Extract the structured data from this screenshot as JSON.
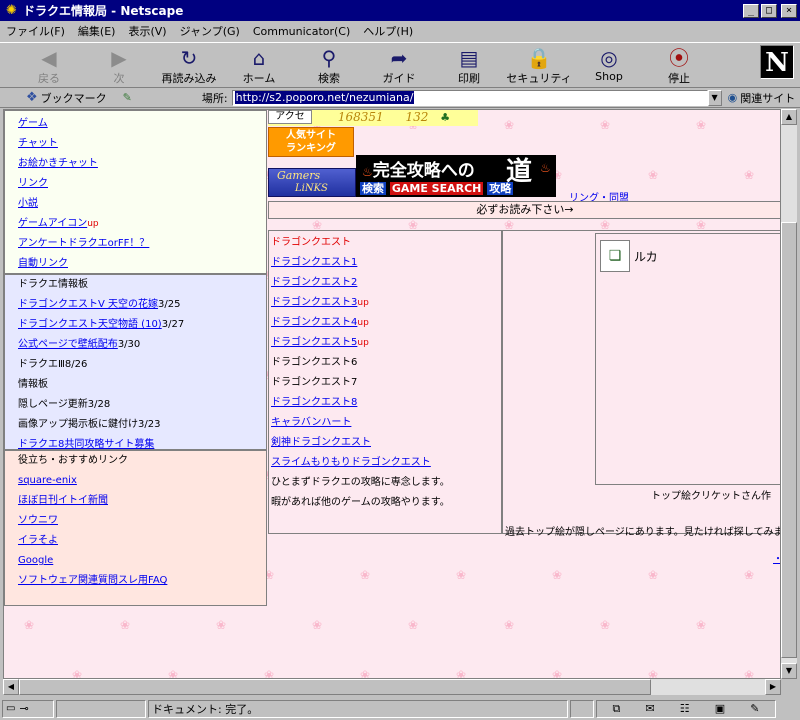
{
  "window": {
    "title": "ドラクエ情報局 - Netscape",
    "minimize": "_",
    "maximize": "□",
    "close": "×"
  },
  "menubar": [
    "ファイル(F)",
    "編集(E)",
    "表示(V)",
    "ジャンプ(G)",
    "Communicator(C)",
    "ヘルプ(H)"
  ],
  "toolbar": [
    {
      "label": "戻る",
      "icon": "back-icon",
      "glyph": "◀",
      "color": "#3a9a3a",
      "disabled": true
    },
    {
      "label": "次",
      "icon": "forward-icon",
      "glyph": "▶",
      "color": "#3a9a3a",
      "disabled": true
    },
    {
      "label": "再読み込み",
      "icon": "reload-icon",
      "glyph": "↻",
      "color": "#1a1a6a",
      "disabled": false
    },
    {
      "label": "ホーム",
      "icon": "home-icon",
      "glyph": "⌂",
      "color": "#1a1a6a",
      "disabled": false
    },
    {
      "label": "検索",
      "icon": "search-icon",
      "glyph": "⚲",
      "color": "#1a1a6a",
      "disabled": false
    },
    {
      "label": "ガイド",
      "icon": "guide-icon",
      "glyph": "➦",
      "color": "#1a1a6a",
      "disabled": false
    },
    {
      "label": "印刷",
      "icon": "print-icon",
      "glyph": "▤",
      "color": "#1a1a6a",
      "disabled": false
    },
    {
      "label": "セキュリティ",
      "icon": "security-icon",
      "glyph": "🔒",
      "color": "#1a1a6a",
      "disabled": false
    },
    {
      "label": "Shop",
      "icon": "shop-icon",
      "glyph": "◎",
      "color": "#1a1a6a",
      "disabled": false
    },
    {
      "label": "停止",
      "icon": "stop-icon",
      "glyph": "⦿",
      "color": "#a01010",
      "disabled": false
    }
  ],
  "logo": "N",
  "locationbar": {
    "bookmarks": "ブックマーク",
    "location_label": "場所:",
    "url": "http://s2.poporo.net/nezumiana/",
    "related": "関連サイト"
  },
  "page": {
    "nav_main": [
      "ゲーム",
      "チャット",
      "お絵かきチャット",
      "リンク",
      "小説",
      "ゲームアイコン",
      "アンケートドラクエorFF！？",
      "自動リンク"
    ],
    "nav_main_up_index": 5,
    "up_mark": "up",
    "nav_info": {
      "heading": "ドラクエ情報板",
      "items": [
        {
          "text": "ドラゴンクエストV 天空の花嫁",
          "suffix": "3/25",
          "link": true
        },
        {
          "text": "ドラゴンクエスト天空物語 (10)",
          "suffix": "3/27",
          "link": true
        },
        {
          "text": "公式ページで壁紙配布",
          "suffix": "3/30",
          "link": true
        },
        {
          "text": "ドラクエⅢ8/26",
          "suffix": "",
          "link": false
        },
        {
          "text": "情報板",
          "suffix": "",
          "link": false
        },
        {
          "text": "隠しページ更新3/28",
          "suffix": "",
          "link": false
        },
        {
          "text": "画像アップ掲示板に鍵付け3/23",
          "suffix": "",
          "link": false
        },
        {
          "text": "ドラクエ8共同攻略サイト募集",
          "suffix": "",
          "link": true
        }
      ]
    },
    "nav_links": {
      "heading": "役立ち・おすすめリンク",
      "items": [
        "square-enix",
        "ほぼ日刊イトイ新聞",
        "ソウニワ",
        "イラそよ",
        "Google",
        "ソフトウェア関連質問スレ用FAQ"
      ]
    },
    "counter": {
      "label": "アクセ",
      "num1": "168351",
      "num2": "132"
    },
    "banners": {
      "ranking_line1": "人気サイト",
      "ranking_line2": "ランキング",
      "gamers_line1": "Gamers",
      "gamers_line2": "LiNKS",
      "kanzen_title": "完全攻略への",
      "kanzen_big": "道",
      "kanzen_left": "検索",
      "kanzen_mid": "GAME SEARCH",
      "kanzen_right": "攻略"
    },
    "link_ring": "リング・同盟",
    "must_read": "必ずお読み下さい→",
    "dq_list": [
      {
        "text": "ドラゴンクエスト",
        "style": "red",
        "up": false
      },
      {
        "text": "ドラゴンクエスト1",
        "style": "link",
        "up": false
      },
      {
        "text": "ドラゴンクエスト2",
        "style": "link",
        "up": false
      },
      {
        "text": "ドラゴンクエスト3",
        "style": "link",
        "up": true
      },
      {
        "text": "ドラゴンクエスト4",
        "style": "link",
        "up": true
      },
      {
        "text": "ドラゴンクエスト5",
        "style": "link",
        "up": true
      },
      {
        "text": "ドラゴンクエスト6",
        "style": "plain",
        "up": false
      },
      {
        "text": "ドラゴンクエスト7",
        "style": "plain",
        "up": false
      },
      {
        "text": "ドラゴンクエスト8",
        "style": "link",
        "up": false
      },
      {
        "text": "キャラバンハート",
        "style": "link",
        "up": false
      },
      {
        "text": "剣神ドラゴンクエスト",
        "style": "link",
        "up": false
      },
      {
        "text": "スライムもりもりドラゴンクエスト",
        "style": "link",
        "up": false
      },
      {
        "text": "ひとまずドラクエの攻略に専念します。",
        "style": "plain",
        "up": false
      },
      {
        "text": "暇があれば他のゲームの攻略やります。",
        "style": "plain",
        "up": false
      }
    ],
    "art": {
      "name": "ルカ",
      "credit": "トップ絵クリケットさん作",
      "note": "過去トップ絵が隠しページにあります。見たければ探してみましょう"
    }
  },
  "status": {
    "text": "ドキュメント: 完了。"
  }
}
